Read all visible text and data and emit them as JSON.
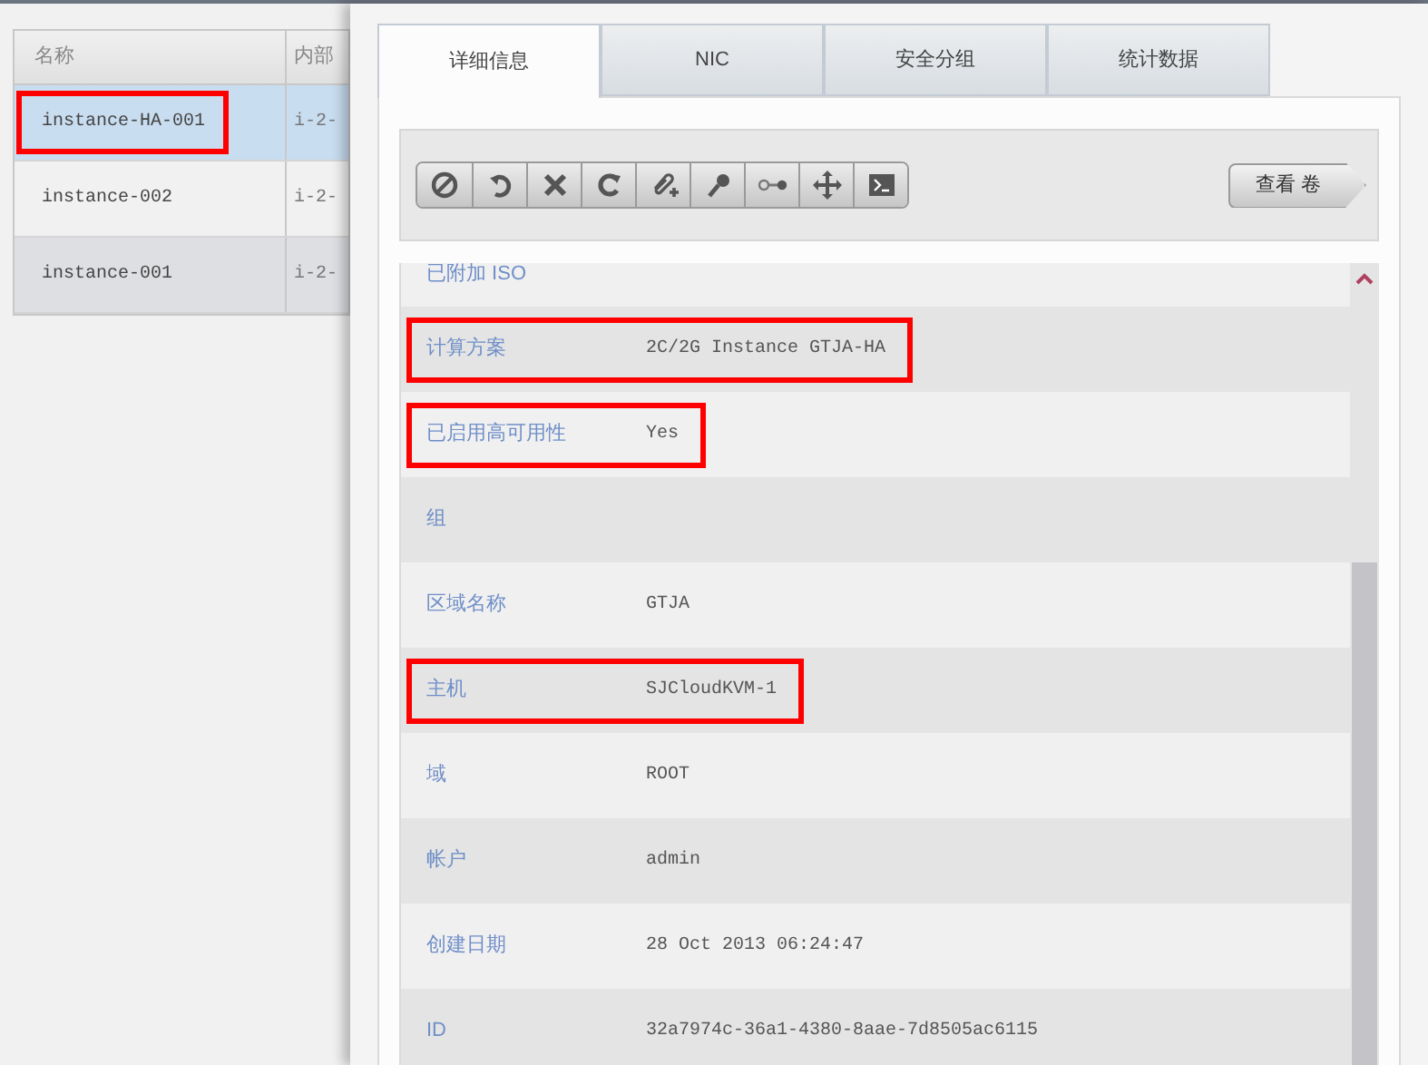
{
  "instance_table": {
    "columns": [
      "名称",
      "内部"
    ],
    "rows": [
      {
        "name": "instance-HA-001",
        "column_2": "i-2-",
        "selected": true,
        "highlighted": true
      },
      {
        "name": "instance-002",
        "column_2": "i-2-",
        "selected": false,
        "highlighted": false
      },
      {
        "name": "instance-001",
        "column_2": "i-2-",
        "selected": false,
        "highlighted": false
      }
    ]
  },
  "tabs": [
    {
      "label": "详细信息",
      "selected": true
    },
    {
      "label": "NIC",
      "selected": false
    },
    {
      "label": "安全分组",
      "selected": false
    },
    {
      "label": "统计数据",
      "selected": false
    }
  ],
  "toolbar": {
    "actions": [
      {
        "kind": "stop"
      },
      {
        "kind": "reboot"
      },
      {
        "kind": "destroy"
      },
      {
        "kind": "restore"
      },
      {
        "kind": "attach"
      },
      {
        "kind": "password"
      },
      {
        "kind": "migrate"
      },
      {
        "kind": "move"
      },
      {
        "kind": "console"
      }
    ],
    "view_button": "查看 卷"
  },
  "details": [
    {
      "label": "已附加 ISO",
      "highlighted": false
    },
    {
      "label": "计算方案",
      "value": "2C/2G Instance GTJA-HA",
      "highlighted": true
    },
    {
      "label": "已启用高可用性",
      "value": "Yes",
      "highlighted": true
    },
    {
      "label": "组",
      "highlighted": false
    },
    {
      "label": "区域名称",
      "value": "GTJA",
      "highlighted": false
    },
    {
      "label": "主机",
      "value": "SJCloudKVM-1",
      "highlighted": true
    },
    {
      "label": "域",
      "value": "ROOT",
      "highlighted": false
    },
    {
      "label": "帐户",
      "value": "admin",
      "highlighted": false
    },
    {
      "label": "创建日期",
      "value": "28 Oct 2013 06:24:47",
      "highlighted": false
    },
    {
      "label": "ID",
      "value": "32a7974c-36a1-4380-8aae-7d8505ac6115",
      "highlighted": false
    }
  ]
}
